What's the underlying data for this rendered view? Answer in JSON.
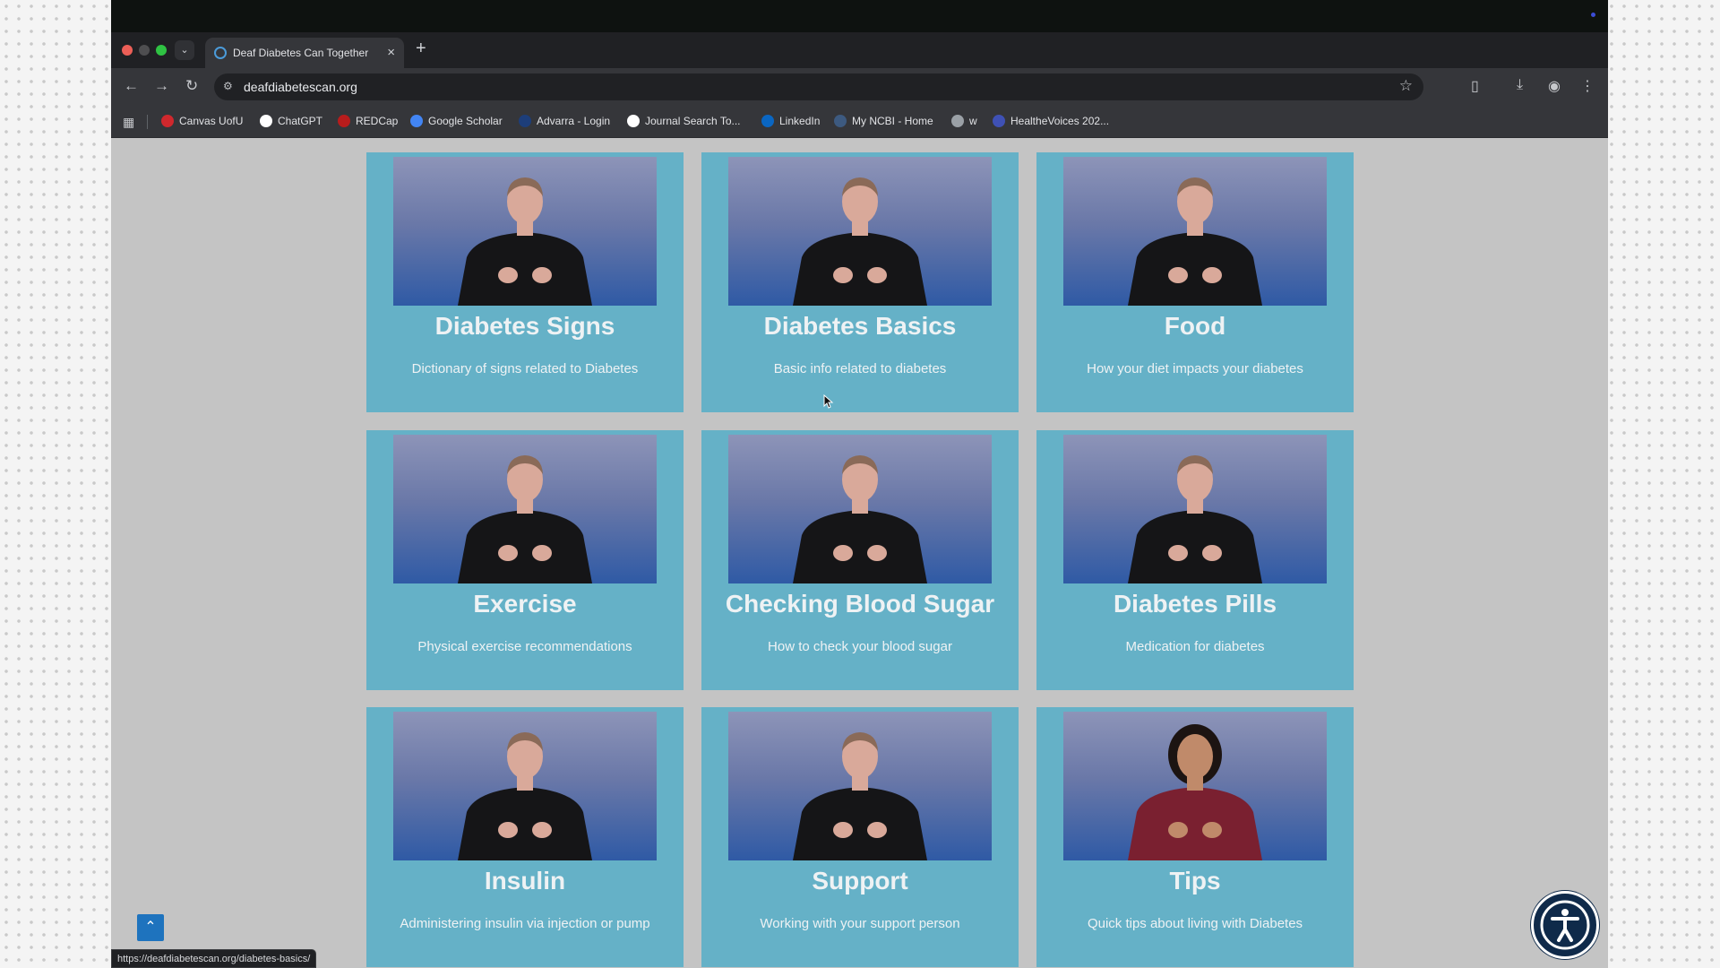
{
  "browser": {
    "tab_title": "Deaf Diabetes Can Together",
    "tab_search_icon": "chevron-down-icon",
    "url": "deafdiabetescan.org",
    "bookmarks": [
      {
        "label": "Canvas UofU",
        "icon_color": "#d0282d"
      },
      {
        "label": "ChatGPT",
        "icon_color": "#ffffff"
      },
      {
        "label": "REDCap",
        "icon_color": "#b71c1c"
      },
      {
        "label": "Google Scholar",
        "icon_color": "#4285f4"
      },
      {
        "label": "Advarra - Login",
        "icon_color": "#1d3e7a"
      },
      {
        "label": "Journal Search To...",
        "icon_color": "#ffffff"
      },
      {
        "label": "LinkedIn",
        "icon_color": "#0a66c2"
      },
      {
        "label": "My NCBI - Home",
        "icon_color": "#3d5a80"
      },
      {
        "label": "w",
        "icon_color": "#9aa0a6"
      },
      {
        "label": "HealtheVoices 202...",
        "icon_color": "#3f51b5"
      }
    ]
  },
  "cards": [
    {
      "title": "Diabetes Signs",
      "description": "Dictionary of signs related to Diabetes",
      "presenter": "man"
    },
    {
      "title": "Diabetes Basics",
      "description": "Basic info related to diabetes",
      "presenter": "man"
    },
    {
      "title": "Food",
      "description": "How your diet impacts your diabetes",
      "presenter": "man"
    },
    {
      "title": "Exercise",
      "description": "Physical exercise recommendations",
      "presenter": "man"
    },
    {
      "title": "Checking Blood Sugar",
      "description": "How to check your blood sugar",
      "presenter": "man"
    },
    {
      "title": "Diabetes Pills",
      "description": "Medication for diabetes",
      "presenter": "man"
    },
    {
      "title": "Insulin",
      "description": "Administering insulin via injection or pump",
      "presenter": "man"
    },
    {
      "title": "Support",
      "description": "Working with your support person",
      "presenter": "man"
    },
    {
      "title": "Tips",
      "description": "Quick tips about living with Diabetes",
      "presenter": "woman"
    }
  ],
  "status_url": "https://deafdiabetescan.org/diabetes-basics/",
  "colors": {
    "card": "#65b1c7",
    "page_bg": "#c4c4c4",
    "scroll_top_button": "#1e73be"
  }
}
